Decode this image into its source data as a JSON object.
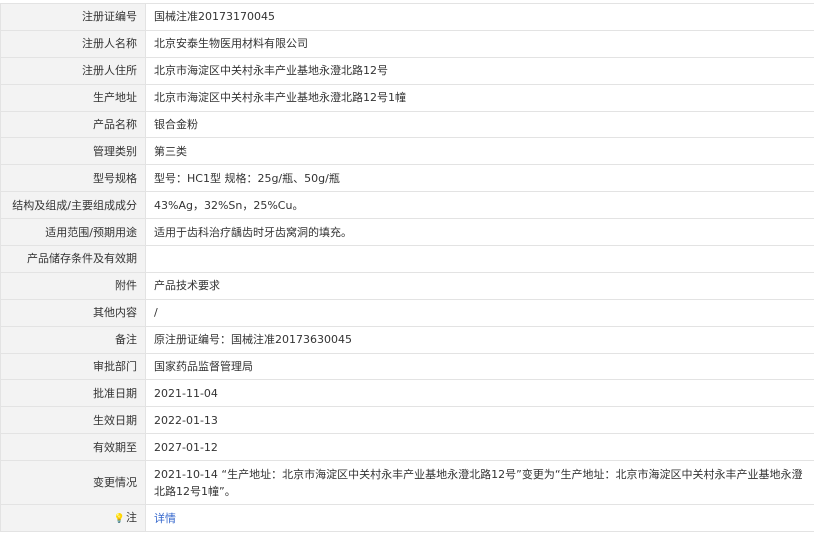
{
  "rows": [
    {
      "label": "注册证编号",
      "value": "国械注准20173170045"
    },
    {
      "label": "注册人名称",
      "value": "北京安泰生物医用材料有限公司"
    },
    {
      "label": "注册人住所",
      "value": "北京市海淀区中关村永丰产业基地永澄北路12号"
    },
    {
      "label": "生产地址",
      "value": "北京市海淀区中关村永丰产业基地永澄北路12号1幢"
    },
    {
      "label": "产品名称",
      "value": "银合金粉"
    },
    {
      "label": "管理类别",
      "value": "第三类"
    },
    {
      "label": "型号规格",
      "value": "型号：HC1型 规格：25g/瓶、50g/瓶"
    },
    {
      "label": "结构及组成/主要组成成分",
      "value": "43%Ag，32%Sn，25%Cu。"
    },
    {
      "label": "适用范围/预期用途",
      "value": "适用于齿科治疗龋齿时牙齿窝洞的填充。"
    },
    {
      "label": "产品储存条件及有效期",
      "value": ""
    },
    {
      "label": "附件",
      "value": "产品技术要求"
    },
    {
      "label": "其他内容",
      "value": "/"
    },
    {
      "label": "备注",
      "value": "原注册证编号：国械注准20173630045"
    },
    {
      "label": "审批部门",
      "value": "国家药品监督管理局"
    },
    {
      "label": "批准日期",
      "value": "2021-11-04"
    },
    {
      "label": "生效日期",
      "value": "2022-01-13"
    },
    {
      "label": "有效期至",
      "value": "2027-01-12"
    },
    {
      "label": "变更情况",
      "value": "2021-10-14 “生产地址：北京市海淀区中关村永丰产业基地永澄北路12号”变更为“生产地址：北京市海淀区中关村永丰产业基地永澄北路12号1幢”。"
    }
  ],
  "note": {
    "icon": "bulb-icon",
    "label": "注",
    "link_text": "详情",
    "link_color": "#3366cc"
  }
}
